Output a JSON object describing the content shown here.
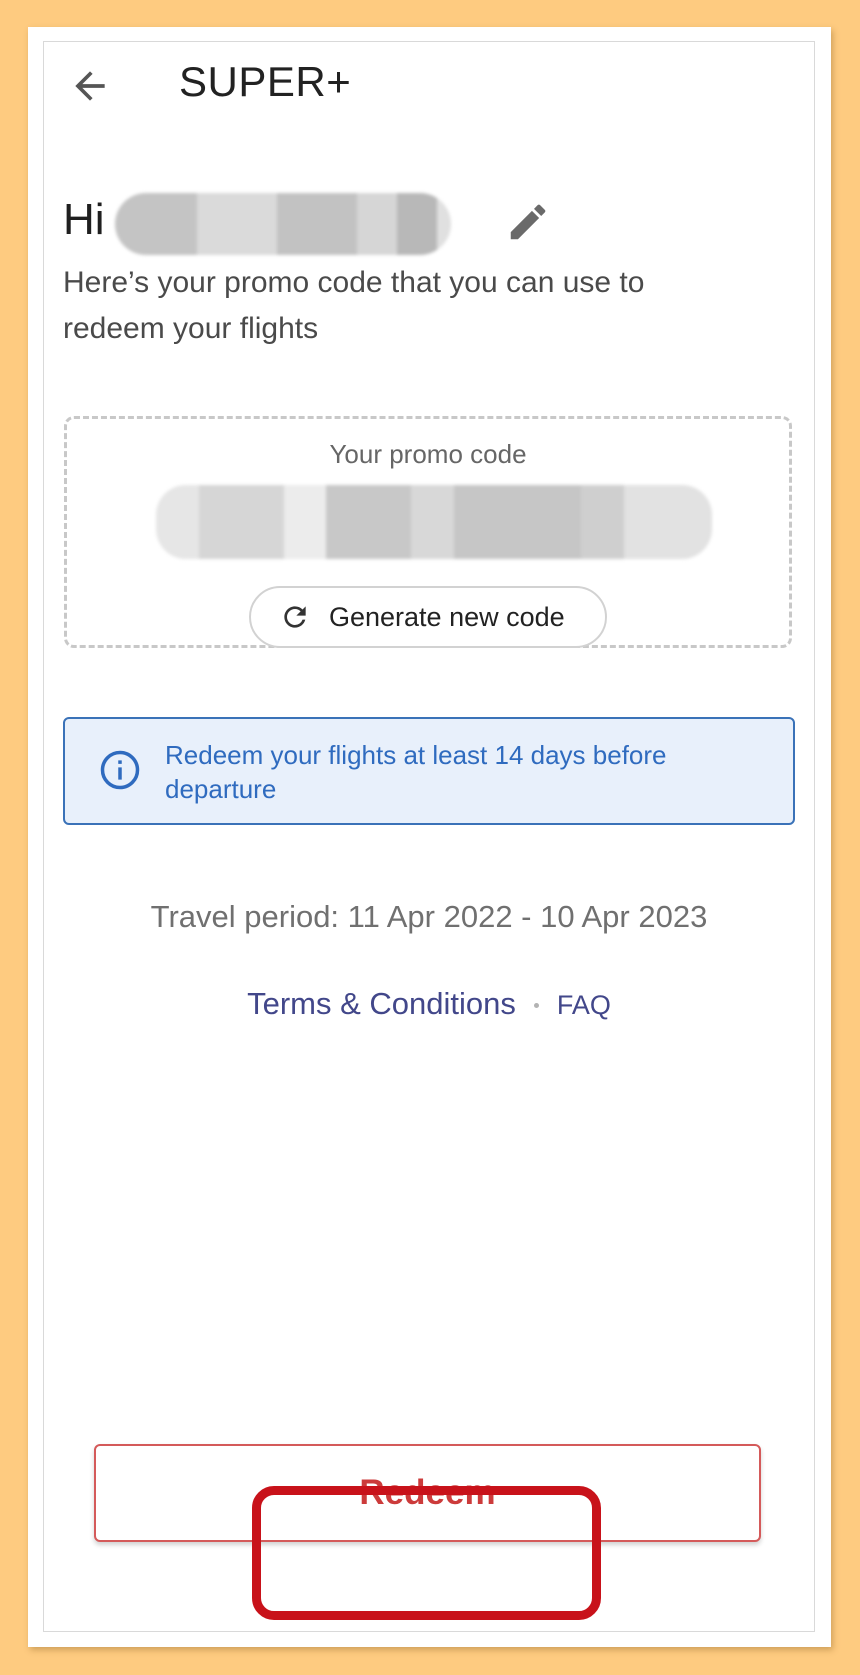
{
  "header": {
    "title": "SUPER+",
    "back_icon": "arrow-left-icon"
  },
  "greeting": {
    "hi": "Hi",
    "edit_icon": "pencil-icon",
    "subtitle": "Here’s your promo code that you can use to redeem your flights"
  },
  "promo": {
    "label": "Your promo code",
    "generate_label": "Generate new code",
    "generate_icon": "refresh-icon"
  },
  "info": {
    "icon": "info-icon",
    "text": "Redeem your flights at least 14 days before departure"
  },
  "travel_period": "Travel period: 11 Apr 2022 - 10 Apr 2023",
  "links": {
    "terms": "Terms & Conditions",
    "faq": "FAQ"
  },
  "footer": {
    "redeem_label": "Redeem"
  },
  "colors": {
    "background": "#fecb80",
    "redeem": "#cc3b3b",
    "highlight": "#c8121a",
    "info_text": "#2f6bbf",
    "link": "#42478a"
  }
}
